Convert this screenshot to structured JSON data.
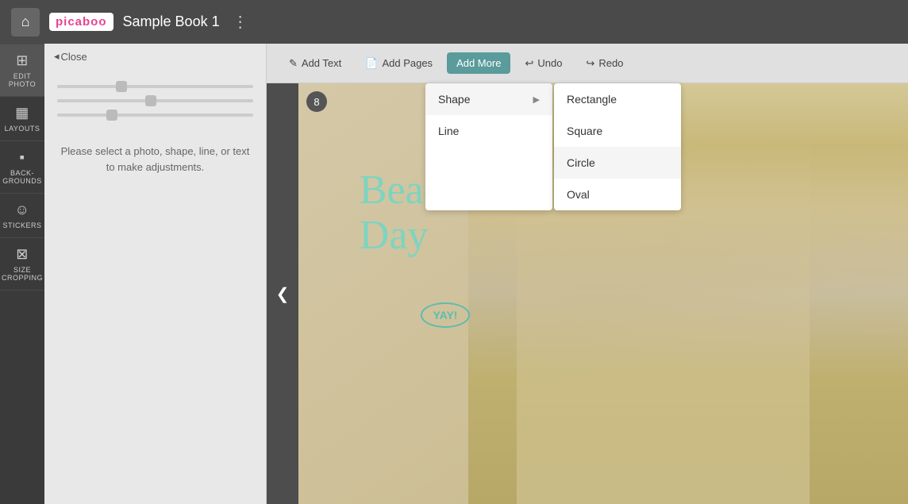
{
  "topbar": {
    "home_icon": "⌂",
    "logo_text": "picaboo",
    "title": "Sample Book 1",
    "more_icon": "⋮"
  },
  "sidebar": {
    "items": [
      {
        "id": "edit-photo",
        "icon": "⊞",
        "label": "EDIT\nPHOTO",
        "active": true
      },
      {
        "id": "layouts",
        "icon": "▦",
        "label": "LAYOUTS",
        "active": false
      },
      {
        "id": "backgrounds",
        "icon": "▪",
        "label": "BACK-\nGROUNDS",
        "active": false
      },
      {
        "id": "stickers",
        "icon": "☺",
        "label": "STICKERS",
        "active": false
      },
      {
        "id": "size-cropping",
        "icon": "⊠",
        "label": "SIZE\nCROPPING",
        "active": false
      }
    ]
  },
  "panel": {
    "close_label": "◂ Close",
    "hint_text": "Please select a photo, shape, line, or text to make adjustments."
  },
  "toolbar": {
    "add_text_label": "Add Text",
    "add_text_icon": "✎",
    "add_pages_label": "Add Pages",
    "add_pages_icon": "📄",
    "add_more_label": "Add More",
    "undo_label": "Undo",
    "undo_icon": "↩",
    "redo_label": "Redo",
    "redo_icon": "↪"
  },
  "dropdown": {
    "shape_label": "Shape",
    "shape_arrow": "▶",
    "line_label": "Line",
    "shapes": [
      {
        "id": "rectangle",
        "label": "Rectangle"
      },
      {
        "id": "square",
        "label": "Square"
      },
      {
        "id": "circle",
        "label": "Circle"
      },
      {
        "id": "oval",
        "label": "Oval"
      }
    ]
  },
  "canvas": {
    "page_number": "8",
    "nav_arrow": "❮",
    "beach_text_line1": "Beach",
    "beach_text_line2": "Day",
    "yay_label": "YAY!"
  },
  "colors": {
    "topbar_bg": "#4a4a4a",
    "sidebar_bg": "#3a3a3a",
    "active_btn": "#5a9b9b",
    "panel_bg": "#e8e8e8"
  }
}
